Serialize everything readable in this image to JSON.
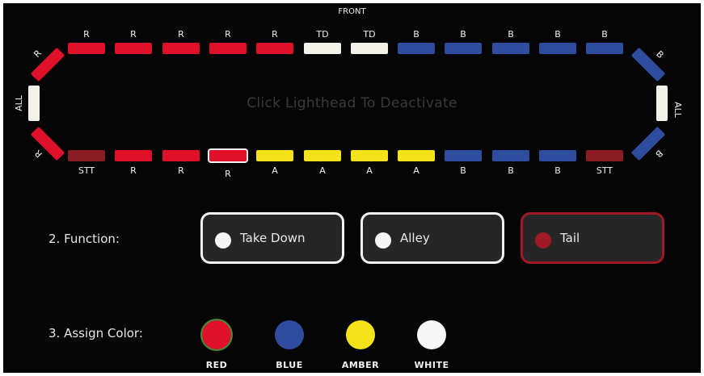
{
  "lightbar": {
    "front_label": "FRONT",
    "hint": "Click Lighthead To Deactivate",
    "top_segments": [
      {
        "label": "R",
        "color": "#e0102a"
      },
      {
        "label": "R",
        "color": "#e0102a"
      },
      {
        "label": "R",
        "color": "#e0102a"
      },
      {
        "label": "R",
        "color": "#e0102a"
      },
      {
        "label": "R",
        "color": "#e0102a"
      },
      {
        "label": "TD",
        "color": "#f4f1e8"
      },
      {
        "label": "TD",
        "color": "#f4f1e8"
      },
      {
        "label": "B",
        "color": "#2f4d9e"
      },
      {
        "label": "B",
        "color": "#2f4d9e"
      },
      {
        "label": "B",
        "color": "#2f4d9e"
      },
      {
        "label": "B",
        "color": "#2f4d9e"
      },
      {
        "label": "B",
        "color": "#2f4d9e"
      }
    ],
    "bottom_segments": [
      {
        "label": "STT",
        "color": "#8c1c24"
      },
      {
        "label": "R",
        "color": "#e0102a"
      },
      {
        "label": "R",
        "color": "#e0102a"
      },
      {
        "label": "R",
        "color": "#e0102a",
        "selected": true
      },
      {
        "label": "A",
        "color": "#f5e21a"
      },
      {
        "label": "A",
        "color": "#f5e21a"
      },
      {
        "label": "A",
        "color": "#f5e21a"
      },
      {
        "label": "A",
        "color": "#f5e21a"
      },
      {
        "label": "B",
        "color": "#2f4d9e"
      },
      {
        "label": "B",
        "color": "#2f4d9e"
      },
      {
        "label": "B",
        "color": "#2f4d9e"
      },
      {
        "label": "STT",
        "color": "#8c1c24"
      }
    ],
    "corners": {
      "top_left": {
        "label": "R",
        "color": "#e0102a"
      },
      "bottom_left": {
        "label": "R",
        "color": "#e0102a"
      },
      "top_right": {
        "label": "B",
        "color": "#2f4d9e"
      },
      "bottom_right": {
        "label": "B",
        "color": "#2f4d9e"
      }
    },
    "ends": {
      "left": {
        "label": "ALL",
        "color": "#f4f1e8"
      },
      "right": {
        "label": "ALL",
        "color": "#f4f1e8"
      }
    }
  },
  "function": {
    "label": "2. Function:",
    "options": [
      {
        "label": "Take Down",
        "selected": false
      },
      {
        "label": "Alley",
        "selected": false
      },
      {
        "label": "Tail",
        "selected": true
      }
    ],
    "selected_color": "#a01a26"
  },
  "assign_color": {
    "label": "3. Assign Color:",
    "options": [
      {
        "label": "RED",
        "color": "#e0102a",
        "selected": true
      },
      {
        "label": "BLUE",
        "color": "#2f4d9e",
        "selected": false
      },
      {
        "label": "AMBER",
        "color": "#f5e21a",
        "selected": false
      },
      {
        "label": "WHITE",
        "color": "#f7f7f7",
        "selected": false
      }
    ]
  }
}
